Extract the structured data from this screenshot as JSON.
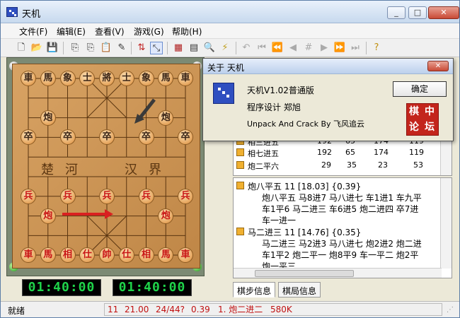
{
  "window": {
    "title": "天机",
    "minimize": "_",
    "maximize": "□",
    "close": "✕"
  },
  "menu": [
    "文件(F)",
    "编辑(E)",
    "查看(V)",
    "游戏(G)",
    "帮助(H)"
  ],
  "toolbar": {
    "icons": [
      "new-file-icon",
      "open-folder-icon",
      "save-icon",
      "copy-icon",
      "copy-board-icon",
      "paste-icon",
      "edit-icon",
      "flip-icon",
      "connect-icon",
      "board-setup-icon",
      "board-view-icon",
      "zoom-icon",
      "think-icon",
      "undo-icon",
      "first-move-icon",
      "prev-five-icon",
      "prev-move-icon",
      "hash-icon",
      "next-move-icon",
      "next-five-icon",
      "last-move-icon",
      "help-icon"
    ]
  },
  "board": {
    "river_left": "楚河",
    "river_right": "汉界",
    "top_row": [
      "車",
      "馬",
      "象",
      "士",
      "將",
      "士",
      "象",
      "馬",
      "車"
    ],
    "top_cannons": [
      "炮",
      "炮"
    ],
    "top_pawns": [
      "卒",
      "卒",
      "卒",
      "卒",
      "卒"
    ],
    "red_pawns": [
      "兵",
      "兵",
      "兵",
      "兵",
      "兵"
    ],
    "red_cannons": [
      "炮",
      "炮"
    ],
    "bottom_row": [
      "車",
      "馬",
      "相",
      "仕",
      "帥",
      "仕",
      "相",
      "馬",
      "車"
    ]
  },
  "clocks": {
    "left": "01:40:00",
    "right": "01:40:00"
  },
  "moves_list": [
    {
      "move": "相三进五",
      "c1": "192",
      "c2": "65",
      "c3": "174",
      "c4": "119"
    },
    {
      "move": "相七进五",
      "c1": "192",
      "c2": "65",
      "c3": "174",
      "c4": "119"
    },
    {
      "move": "炮二平六",
      "c1": "29",
      "c2": "35",
      "c3": "23",
      "c4": "53"
    }
  ],
  "analysis": {
    "lines": [
      "炮八平五  11  [18.03]  {0.39}",
      "炮八平五 马8进7 马八进七 车1进1 车九平",
      "车1平6 马二进三 车6进5 炮二进四 卒7进",
      "车一进一",
      "马二进三  11  [14.76]  {0.35}",
      "马二进三 马2进3 马八进七 炮2进2 炮二进",
      "车1平2 炮二平一 炮8平9 车一平二 炮2平",
      "炮一平三"
    ]
  },
  "tabs": [
    "棋步信息",
    "棋局信息"
  ],
  "status": {
    "ready": "就绪",
    "depth": "11",
    "time": "21.00",
    "progress": "24/44?",
    "score": "0.39",
    "best": "1. 炮二进二",
    "nodes": "580K"
  },
  "dialog": {
    "title": "关于 天机",
    "close": "✕",
    "version": "天机V1.02普通版",
    "design": "程序设计  郑旭",
    "crack": "Unpack And Crack By 飞风追云",
    "ok": "确定",
    "seal": [
      "棋",
      "中",
      "论",
      "坛"
    ]
  },
  "colors": {
    "red_piece": "#c81414",
    "black_piece": "#3a2416",
    "clock_digits": "#1fd34a",
    "status_text": "#c01010",
    "arrow_red": "#d92020",
    "arrow_dark": "#3a3a3a"
  }
}
